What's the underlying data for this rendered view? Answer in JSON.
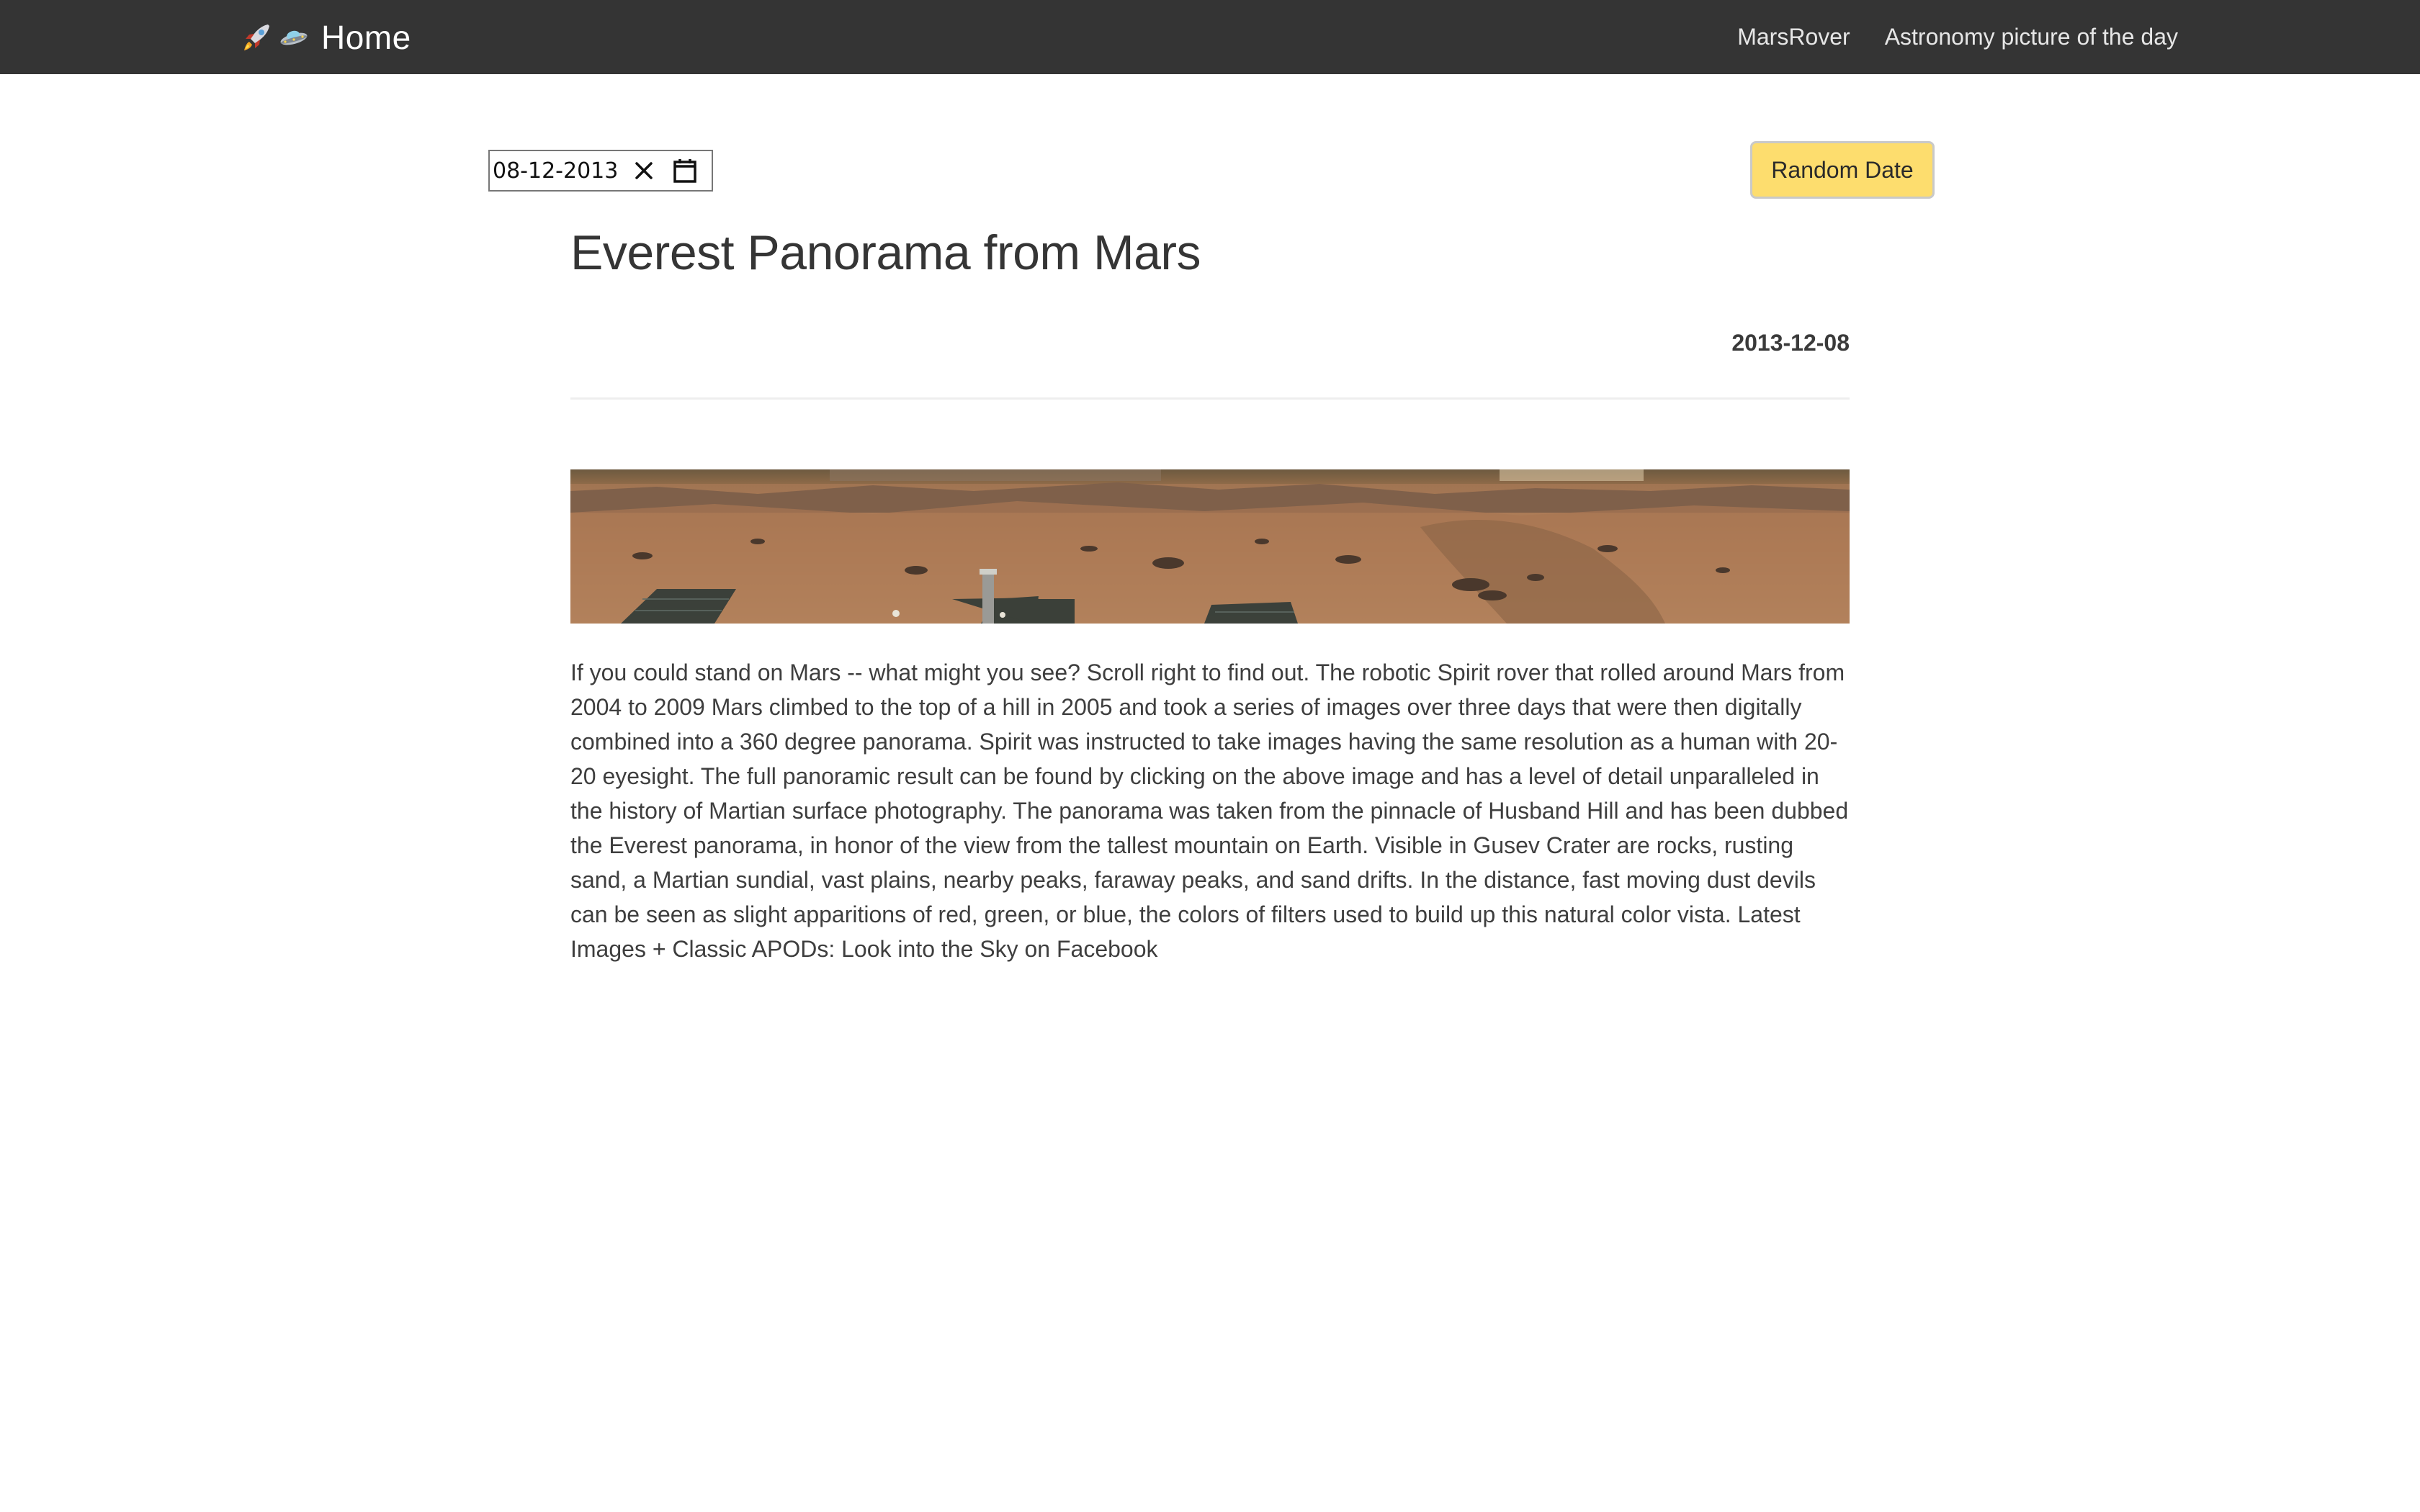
{
  "navbar": {
    "brand_label": "Home",
    "brand_icons": [
      "rocket-icon",
      "ufo-icon"
    ],
    "links": [
      {
        "label": "MarsRover"
      },
      {
        "label": "Astronomy picture of the day"
      }
    ],
    "background": "#343434"
  },
  "controls": {
    "date_value": "08-12-2013",
    "clear_icon": "close-icon",
    "calendar_icon": "calendar-icon",
    "random_button_label": "Random Date",
    "random_button_color": "#fddd6e"
  },
  "apod": {
    "title": "Everest Panorama from Mars",
    "date": "2013-12-08",
    "image_alt": "Everest Panorama from Mars",
    "explanation": "If you could stand on Mars -- what might you see? Scroll right to find out. The robotic Spirit rover that rolled around Mars from 2004 to 2009 Mars climbed to the top of a hill in 2005 and took a series of images over three days that were then digitally combined into a 360 degree panorama. Spirit was instructed to take images having the same resolution as a human with 20-20 eyesight. The full panoramic result can be found by clicking on the above image and has a level of detail unparalleled in the history of Martian surface photography. The panorama was taken from the pinnacle of Husband Hill and has been dubbed the Everest panorama, in honor of the view from the tallest mountain on Earth. Visible in Gusev Crater are rocks, rusting sand, a Martian sundial, vast plains, nearby peaks, faraway peaks, and sand drifts. In the distance, fast moving dust devils can be seen as slight apparitions of red, green, or blue, the colors of filters used to build up this natural color vista. Latest Images + Classic APODs: Look into the Sky on Facebook"
  }
}
